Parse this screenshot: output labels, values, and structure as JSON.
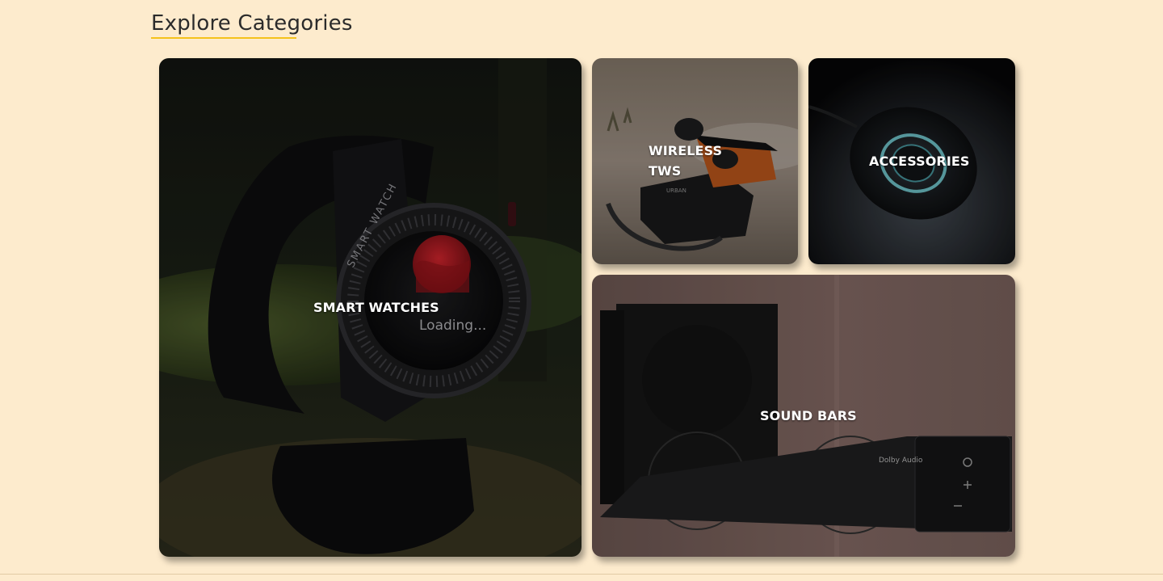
{
  "section": {
    "title": "Explore Categories",
    "accent_color": "#f5c21b"
  },
  "background_color": "#fdebcd",
  "categories": [
    {
      "id": "smart-watches",
      "label": "SMART WATCHES",
      "watch_bezel_text": "SMART WATCH",
      "watch_screen_text": "Loading..."
    },
    {
      "id": "wireless-tws",
      "label_line1": "WIRELESS",
      "label_line2": "TWS",
      "brand_mark": "URBAN"
    },
    {
      "id": "accessories",
      "label": "ACCESSORIES"
    },
    {
      "id": "sound-bars",
      "label": "SOUND BARS",
      "brand_mark": "Dolby Audio"
    }
  ]
}
